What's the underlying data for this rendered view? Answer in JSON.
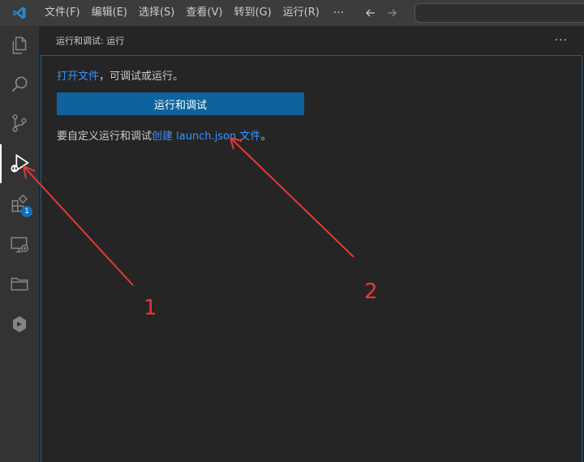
{
  "menubar": {
    "items": [
      "文件(F)",
      "编辑(E)",
      "选择(S)",
      "查看(V)",
      "转到(G)",
      "运行(R)"
    ],
    "more": "···"
  },
  "activitybar": {
    "extensions_badge": "1"
  },
  "sidebar": {
    "title": "运行和调试: 运行",
    "more": "···",
    "open_file_link": "打开文件",
    "open_file_suffix": "，可调试或运行。",
    "run_debug_button": "运行和调试",
    "customize_prefix": "要自定义运行和调试",
    "create_launch_link": "创建 launch.json 文件",
    "customize_suffix": "。"
  },
  "annotations": {
    "label_1": "1",
    "label_2": "2"
  },
  "colors": {
    "accent": "#0e639c",
    "link": "#3794ff",
    "annotation": "#e53935"
  }
}
